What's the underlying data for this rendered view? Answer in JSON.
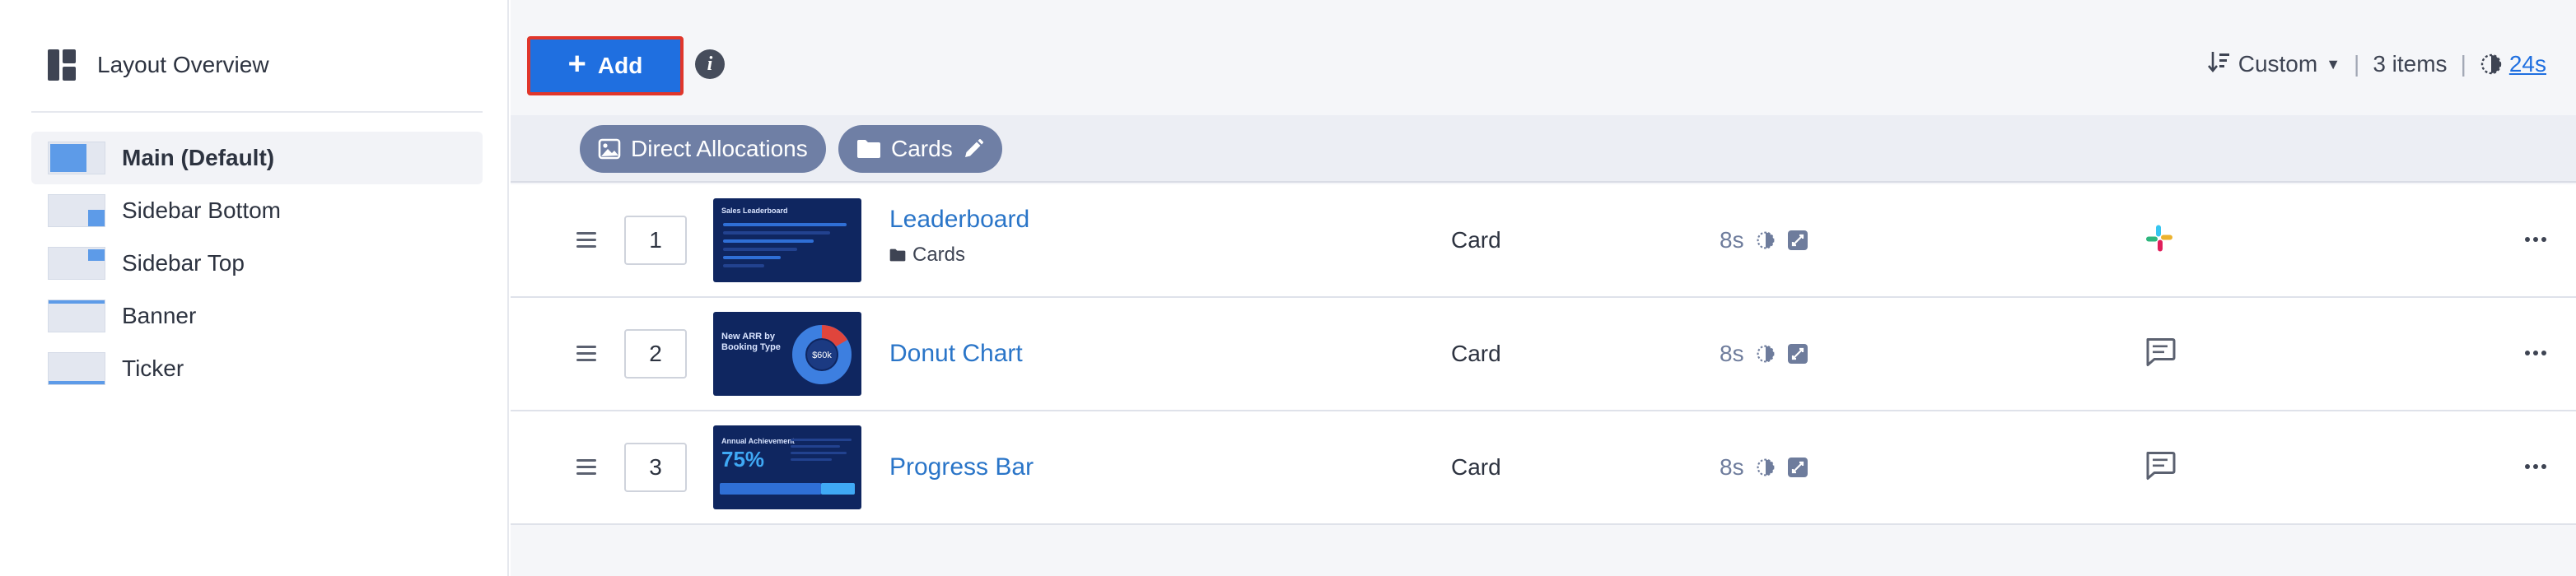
{
  "sidebar": {
    "title": "Layout Overview",
    "items": [
      {
        "label": "Main (Default)",
        "active": true
      },
      {
        "label": "Sidebar Bottom",
        "active": false
      },
      {
        "label": "Sidebar Top",
        "active": false
      },
      {
        "label": "Banner",
        "active": false
      },
      {
        "label": "Ticker",
        "active": false
      }
    ]
  },
  "toolbar": {
    "add_label": "Add",
    "sort_label": "Custom",
    "item_count": "3 items",
    "total_duration": "24s"
  },
  "chips": [
    {
      "label": "Direct Allocations",
      "icon": "image-icon"
    },
    {
      "label": "Cards",
      "icon": "folder-icon",
      "editable": true
    }
  ],
  "rows": [
    {
      "position": "1",
      "name": "Leaderboard",
      "folder": "Cards",
      "thumb_title": "Sales Leaderboard",
      "type": "Card",
      "duration": "8s",
      "channel_icon": "slack-icon"
    },
    {
      "position": "2",
      "name": "Donut Chart",
      "folder": "",
      "thumb_title": "New ARR by Booking Type",
      "thumb_value": "$60k",
      "type": "Card",
      "duration": "8s",
      "channel_icon": "message-icon"
    },
    {
      "position": "3",
      "name": "Progress Bar",
      "folder": "",
      "thumb_title": "Annual Achievement",
      "thumb_value": "75%",
      "type": "Card",
      "duration": "8s",
      "channel_icon": "message-icon"
    }
  ],
  "colors": {
    "accent": "#1f6fe0",
    "link": "#2a75c8",
    "chip": "#6f7fa5",
    "highlight_border": "#e0362b"
  }
}
